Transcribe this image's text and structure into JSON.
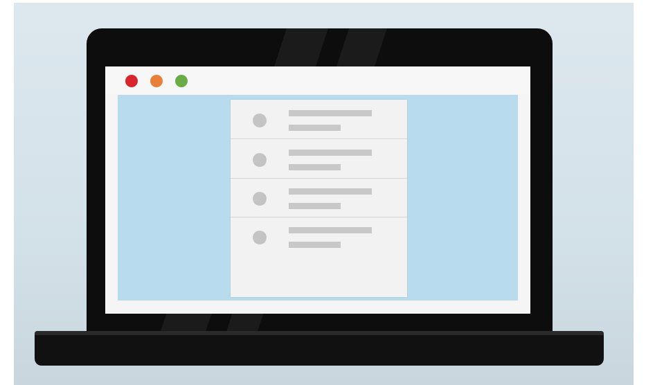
{
  "window": {
    "controls": [
      {
        "name": "close",
        "color": "#d9262e"
      },
      {
        "name": "minimize",
        "color": "#e7813a"
      },
      {
        "name": "maximize",
        "color": "#6aac46"
      }
    ]
  },
  "list": {
    "items": [
      {
        "icon": "placeholder-avatar-icon"
      },
      {
        "icon": "placeholder-avatar-icon"
      },
      {
        "icon": "placeholder-avatar-icon"
      },
      {
        "icon": "placeholder-avatar-icon"
      }
    ]
  },
  "colors": {
    "screen_background": "#b8dcee",
    "panel": "#f2f2f2",
    "placeholder": "#c8c8c8",
    "laptop": "#0d0d0d"
  }
}
